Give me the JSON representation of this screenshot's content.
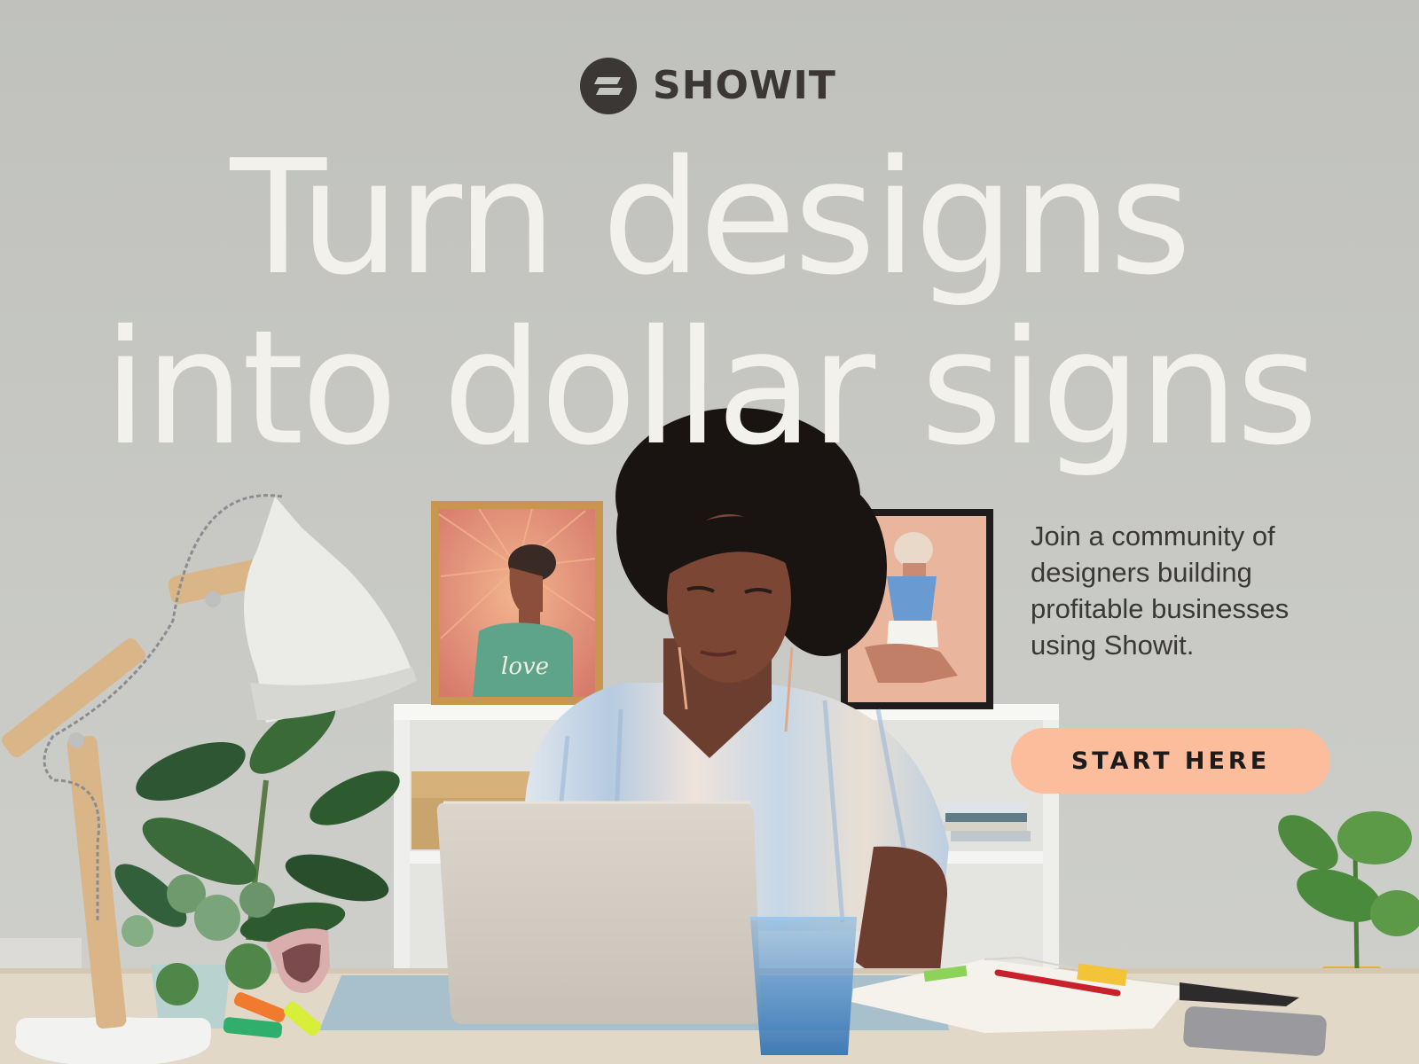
{
  "brand": {
    "name": "SHOWIT",
    "icon": "showit-logo-icon"
  },
  "hero": {
    "headline_line1": "Turn designs",
    "headline_line2": "into dollar signs",
    "subtext": "Join a community of designers building profitable businesses using Showit.",
    "cta_label": "START HERE"
  },
  "artwork": {
    "poster_text": "love"
  },
  "colors": {
    "background": "#c4c5c1",
    "headline": "#f3f1ec",
    "cta_background": "#fbbd9c",
    "brand_dark": "#3b3735"
  }
}
